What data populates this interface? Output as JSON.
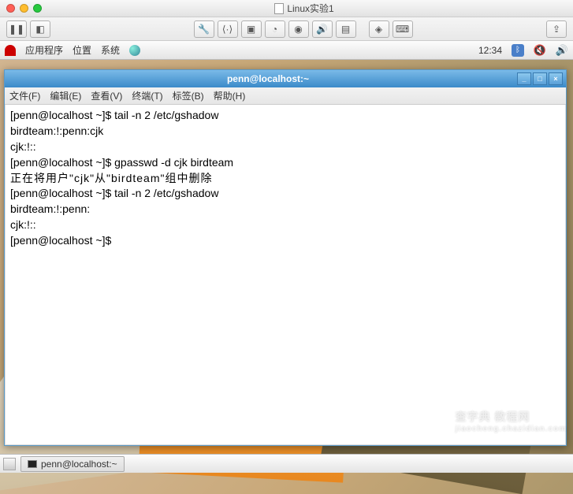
{
  "outer": {
    "title": "Linux实验1"
  },
  "gnome_panel": {
    "apps": "应用程序",
    "places": "位置",
    "system": "系统",
    "clock": "12:34"
  },
  "terminal": {
    "title": "penn@localhost:~",
    "menus": {
      "file": "文件(F)",
      "edit": "编辑(E)",
      "view": "查看(V)",
      "terminal": "终端(T)",
      "tabs": "标签(B)",
      "help": "帮助(H)"
    },
    "lines": [
      "[penn@localhost ~]$ tail -n 2 /etc/gshadow",
      "birdteam:!:penn:cjk",
      "cjk:!::",
      "[penn@localhost ~]$ gpasswd -d cjk birdteam",
      "正在将用户\"cjk\"从\"birdteam\"组中删除",
      "[penn@localhost ~]$ tail -n 2 /etc/gshadow",
      "birdteam:!:penn:",
      "cjk:!::",
      "[penn@localhost ~]$ "
    ]
  },
  "taskbar": {
    "item": "penn@localhost:~"
  },
  "watermark": {
    "main": "查字典 教程网",
    "sub": "jiaocheng.chazidian.com"
  }
}
